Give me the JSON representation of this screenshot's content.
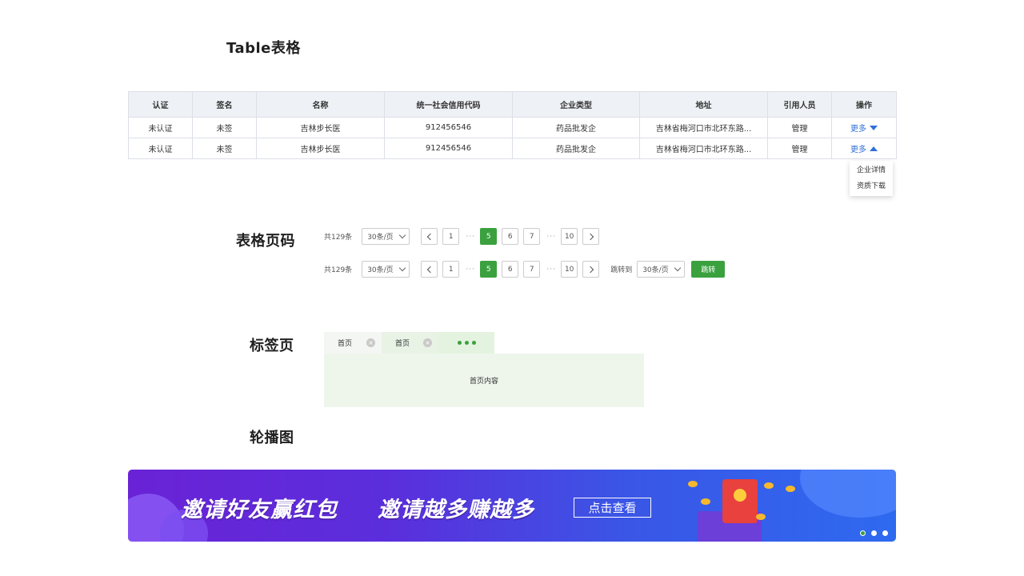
{
  "sections": {
    "table_title": "Table表格",
    "pager_title": "表格页码",
    "tabs_title": "标签页",
    "carousel_title": "轮播图"
  },
  "table": {
    "headers": [
      "认证",
      "签名",
      "名称",
      "统一社会信用代码",
      "企业类型",
      "地址",
      "引用人员",
      "操作"
    ],
    "rows": [
      {
        "auth": "未认证",
        "sign": "未签",
        "name": "吉林步长医",
        "code": "912456546",
        "type": "药品批发企",
        "address": "吉林省梅河口市北环东路...",
        "staff": "管理",
        "action": "更多"
      },
      {
        "auth": "未认证",
        "sign": "未签",
        "name": "吉林步长医",
        "code": "912456546",
        "type": "药品批发企",
        "address": "吉林省梅河口市北环东路...",
        "staff": "管理",
        "action": "更多"
      }
    ],
    "dropdown": [
      "企业详情",
      "资质下载"
    ],
    "colors": {
      "unverified": "#e5484d",
      "manage": "#3aa13e",
      "more": "#2f6fdb"
    }
  },
  "pager": {
    "total": "共129条",
    "page_size": "30条/页",
    "pages": [
      "1",
      "5",
      "6",
      "7",
      "10"
    ],
    "current": "5",
    "jump_label": "跳转到",
    "jump_size": "30条/页",
    "go": "跳转",
    "accent": "#3aa13e"
  },
  "tabs": {
    "items": [
      "首页",
      "首页"
    ],
    "content": "首页内容"
  },
  "carousel": {
    "text1": "邀请好友赢红包",
    "text2": "邀请越多赚越多",
    "button": "点击查看",
    "slide_count": 3,
    "active_slide": 1
  }
}
